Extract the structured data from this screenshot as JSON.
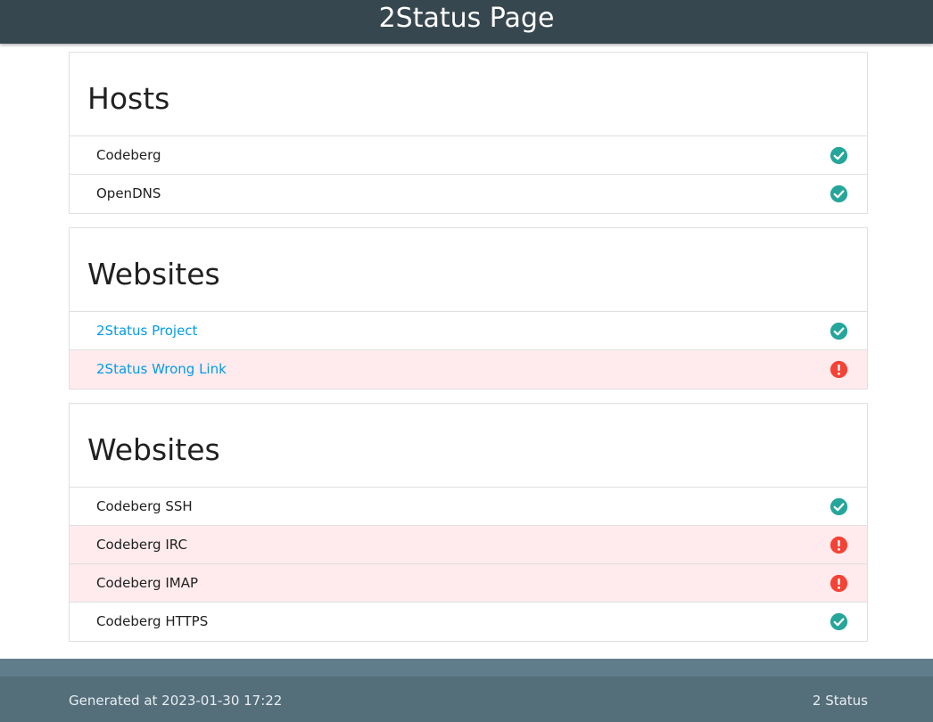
{
  "header": {
    "title": "2Status Page"
  },
  "colors": {
    "header_bg": "#37474f",
    "ok": "#26a69a",
    "error": "#f44336",
    "link": "#039be5",
    "down_row_bg": "#ffebee",
    "footer_bg": "#546e7a"
  },
  "sections": [
    {
      "title": "Hosts",
      "items": [
        {
          "label": "Codeberg",
          "status": "ok",
          "icon": "check-circle-icon"
        },
        {
          "label": "OpenDNS",
          "status": "ok",
          "icon": "check-circle-icon"
        }
      ]
    },
    {
      "title": "Websites",
      "items": [
        {
          "label": "2Status Project",
          "status": "ok",
          "icon": "check-circle-icon",
          "link": true
        },
        {
          "label": "2Status Wrong Link",
          "status": "error",
          "icon": "alert-circle-icon",
          "link": true
        }
      ]
    },
    {
      "title": "Websites",
      "items": [
        {
          "label": "Codeberg SSH",
          "status": "ok",
          "icon": "check-circle-icon"
        },
        {
          "label": "Codeberg IRC",
          "status": "error",
          "icon": "alert-circle-icon"
        },
        {
          "label": "Codeberg IMAP",
          "status": "error",
          "icon": "alert-circle-icon"
        },
        {
          "label": "Codeberg HTTPS",
          "status": "ok",
          "icon": "check-circle-icon"
        }
      ]
    }
  ],
  "footer": {
    "generated": "Generated at 2023-01-30 17:22",
    "brand": "2 Status"
  }
}
